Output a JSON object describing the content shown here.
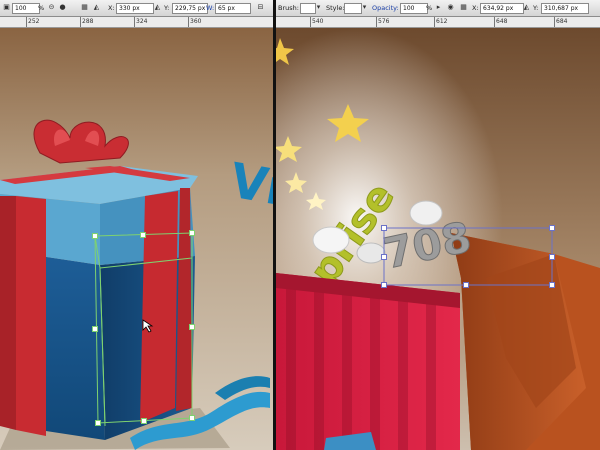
{
  "left_panel": {
    "toolbar": {
      "zoom_value": "100",
      "zoom_unit": "%",
      "x_label": "X:",
      "x_value": "330 px",
      "y_label": "Y:",
      "y_value": "229,75 px",
      "w_label": "W:",
      "w_value": "65 px"
    },
    "ruler_labels": [
      "252",
      "288",
      "324",
      "360"
    ]
  },
  "right_panel": {
    "toolbar": {
      "brush_label": "Brush:",
      "style_label": "Style:",
      "opacity_label": "Opacity:",
      "opacity_value": "100",
      "opacity_unit": "%",
      "x_label": "X:",
      "x_value": "634,92 px",
      "y_label": "Y:",
      "y_value": "310,687 px"
    },
    "ruler_labels": [
      "540",
      "576",
      "612",
      "648",
      "684"
    ],
    "canvas_text": {
      "number_text": "708",
      "word_text": "prise"
    }
  },
  "left_canvas_text": {
    "partial_letters": "Vi"
  },
  "colors": {
    "background_top": "#735034",
    "background_bottom": "#cfc4b2",
    "box_blue": "#1a5f97",
    "box_lid_blue": "#5aa6cf",
    "ribbon_red": "#c62a30",
    "stripe_red": "#d81e3f",
    "orange_box": "#c25622",
    "star_yellow": "#f3d04e",
    "selection_green": "#7fd26f",
    "selection_blue": "#6b72c8",
    "lime_letters": "#b3c02a"
  }
}
